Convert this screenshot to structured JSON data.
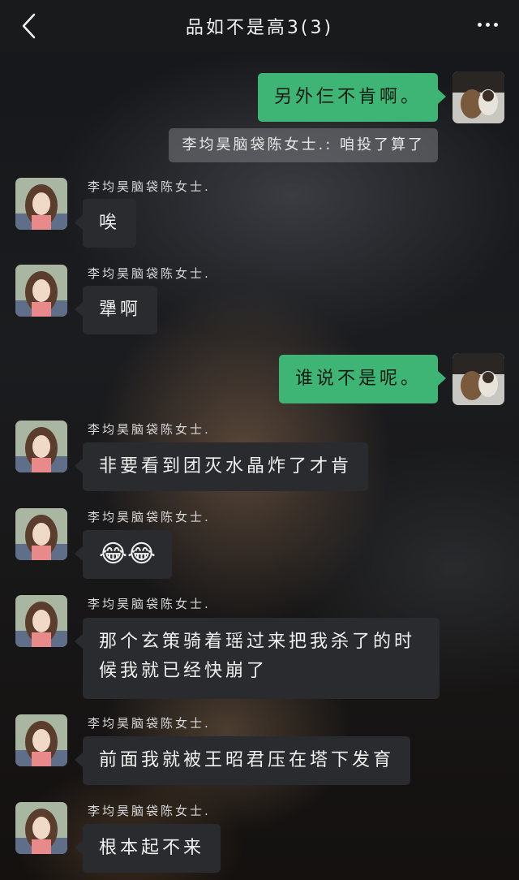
{
  "header": {
    "title": "品如不是高3(3)",
    "back_icon": "chevron-left-icon",
    "more_icon": "more-dots-icon"
  },
  "sender_name": "李均昊脑袋陈女士.",
  "messages": [
    {
      "from": "me",
      "text": "另外仨不肯啊。"
    },
    {
      "from": "me_quote",
      "text": "李均昊脑袋陈女士.: 咱投了算了"
    },
    {
      "from": "other",
      "text": "唉"
    },
    {
      "from": "other",
      "text": "犟啊"
    },
    {
      "from": "me",
      "text": "谁说不是呢。"
    },
    {
      "from": "other",
      "text": "非要看到团灭水晶炸了才肯"
    },
    {
      "from": "other",
      "text": "😂😂"
    },
    {
      "from": "other",
      "text": "那个玄策骑着瑶过来把我杀了的时候我就已经快崩了"
    },
    {
      "from": "other",
      "text": "前面我就被王昭君压在塔下发育"
    },
    {
      "from": "other",
      "text": "根本起不来"
    }
  ],
  "colors": {
    "my_bubble": "#3eb575",
    "other_bubble": "#2a2b2e",
    "topbar": "#191a1c"
  }
}
